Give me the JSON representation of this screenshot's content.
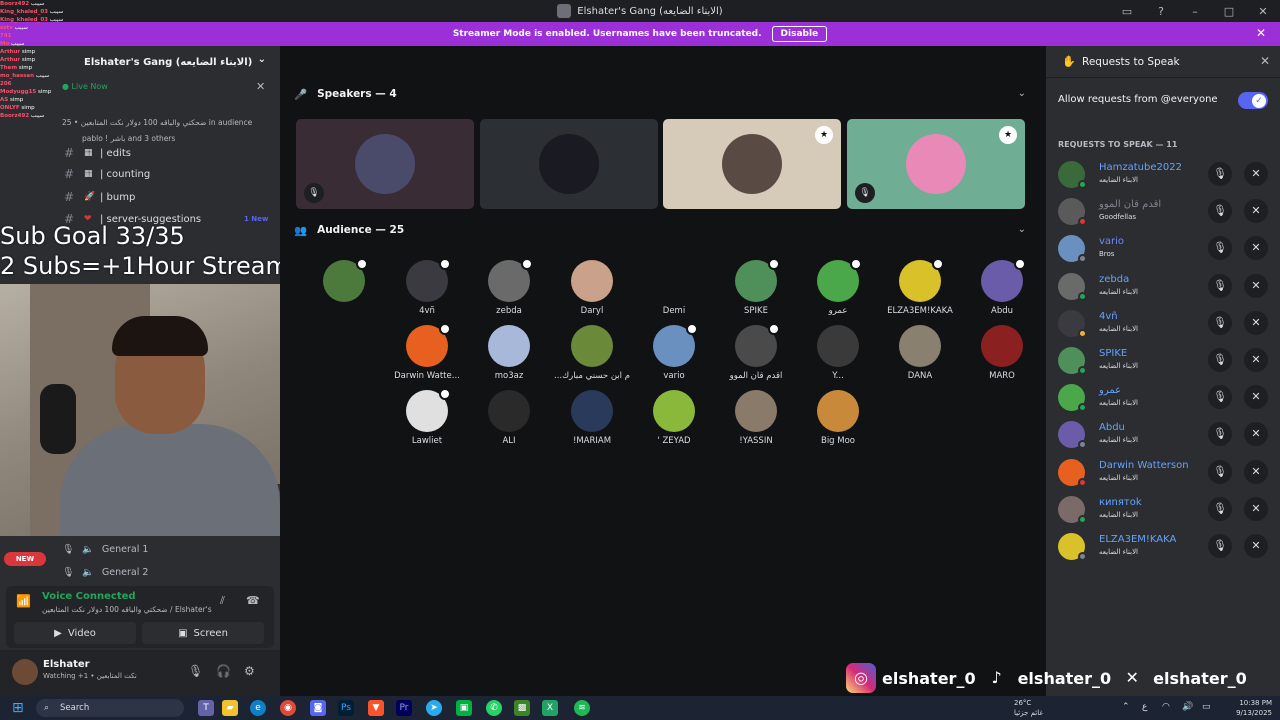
{
  "window": {
    "title": "Elshater's Gang (الابناء الضايعه)",
    "controls": [
      "inbox-icon",
      "help-icon",
      "minimize-icon",
      "maximize-icon",
      "close-icon"
    ]
  },
  "banner": {
    "text": "Streamer Mode is enabled. Usernames have been truncated.",
    "button": "Disable",
    "close": "✕",
    "color": "#9b30d9"
  },
  "sidebar": {
    "server_name": "Elshater's Gang (الابناء الضايعه)",
    "live_label": "Live Now",
    "live_desc": "ضحكتي والباقه 100 دولار نكت المتابعين • 25 in audience",
    "live_sub": "pablo ! باشر and 3 others",
    "channels": [
      {
        "emoji": "▦",
        "name": "| edits",
        "new": ""
      },
      {
        "emoji": "▦",
        "name": "| counting",
        "new": ""
      },
      {
        "emoji": "🚀",
        "name": "| bump",
        "new": ""
      },
      {
        "emoji": "❤",
        "name": "| server-suggestions",
        "new": "1 New"
      }
    ],
    "voice_channels": [
      "General 1",
      "General 2"
    ],
    "new_badge": "NEW"
  },
  "overlay": {
    "sub_goal": "Sub Goal 33/35",
    "subs_line": "2 Subs=+1Hour Stream",
    "chat": [
      {
        "user": "Boorz492",
        "msg": "سيبب"
      },
      {
        "user": "King_khaled_03",
        "msg": "سيبب"
      },
      {
        "user": "King_khaled_03",
        "msg": "سيبب"
      },
      {
        "user": "sstv",
        "msg": "سيبب"
      },
      {
        "user": "741",
        "msg": ""
      },
      {
        "user": "Mo",
        "msg": "سيبب"
      },
      {
        "user": "Arthur",
        "msg": "simp"
      },
      {
        "user": "Arthur",
        "msg": "simp"
      },
      {
        "user": "Them",
        "msg": "simp"
      },
      {
        "user": "mo_hassan",
        "msg": "سيبب"
      },
      {
        "user": "206",
        "msg": ""
      },
      {
        "user": "Modyugg15",
        "msg": "simp"
      },
      {
        "user": "AS",
        "msg": "simp"
      },
      {
        "user": "ONLYF",
        "msg": "simp"
      },
      {
        "user": "Boorz492",
        "msg": "سيبب"
      }
    ]
  },
  "voice_panel": {
    "title": "Voice Connected",
    "subtitle": "ضحكتي والباقه 100 دولار نكت المتابعين / Elshater's...",
    "video_label": "Video",
    "screen_label": "Screen"
  },
  "user": {
    "name": "Elshater",
    "status": "Watching +1 • نكت المتابعين"
  },
  "stage": {
    "speakers_title": "Speakers — 4",
    "audience_title": "Audience — 25",
    "speakers": [
      {
        "bg": "#3a2c34",
        "ava": "#4a4a6a",
        "badge": false,
        "mute": true
      },
      {
        "bg": "#2c2f33",
        "ava": "#1a1a22",
        "badge": false,
        "mute": false
      },
      {
        "bg": "#d6cbb9",
        "ava": "#5a4a44",
        "badge": true,
        "mute": false
      },
      {
        "bg": "#6fae95",
        "ava": "#e889b8",
        "badge": true,
        "mute": true
      }
    ],
    "audience": [
      {
        "name": "",
        "color": "#4b7a3c",
        "mod": true
      },
      {
        "name": "4vñ",
        "color": "#3a3a40",
        "mod": true
      },
      {
        "name": "zebda",
        "color": "#6a6a6a",
        "mod": true
      },
      {
        "name": "Daryl",
        "color": "#caa18a",
        "mod": false
      },
      {
        "name": "Demi",
        "color": "#111214",
        "mod": false
      },
      {
        "name": "SPIKE",
        "color": "#4f8f5a",
        "mod": true
      },
      {
        "name": "عمرو",
        "color": "#4aa84a",
        "mod": true
      },
      {
        "name": "ELZA3EM!KAKA",
        "color": "#d9c12a",
        "mod": true
      },
      {
        "name": "Abdu",
        "color": "#6a5ca8",
        "mod": true
      },
      {
        "name": "Darwin Watte...",
        "color": "#e86020",
        "mod": true
      },
      {
        "name": "mo3az",
        "color": "#a8b8d8",
        "mod": false
      },
      {
        "name": "...م ابن حسني مبارك",
        "color": "#6a8a3a",
        "mod": false
      },
      {
        "name": "vario",
        "color": "#6a90c0",
        "mod": true
      },
      {
        "name": "اقدم قان الموو",
        "color": "#4a4a4a",
        "mod": true
      },
      {
        "name": "Y...",
        "color": "#3a3a3a",
        "mod": false
      },
      {
        "name": "DANA",
        "color": "#8a8070",
        "mod": false
      },
      {
        "name": "MARO",
        "color": "#8a2020",
        "mod": false
      },
      {
        "name": "Lawliet",
        "color": "#e0e0e0",
        "mod": true
      },
      {
        "name": "ALI",
        "color": "#2a2a2a",
        "mod": false
      },
      {
        "name": "!MARIAM",
        "color": "#2a3a5a",
        "mod": false
      },
      {
        "name": "' ZEYAD",
        "color": "#8ab83a",
        "mod": false
      },
      {
        "name": "!YASSIN",
        "color": "#8a7a6a",
        "mod": false
      },
      {
        "name": "Big Moo",
        "color": "#c88a3a",
        "mod": false
      }
    ]
  },
  "requests": {
    "title": "Requests to Speak",
    "allow_label": "Allow requests from @everyone",
    "list_title": "REQUESTS TO SPEAK — 11",
    "items": [
      {
        "name": "Hamzatube2022",
        "role": "الابناء الضايعه",
        "color": "#63a3ff",
        "ava": "#3a6a3a",
        "dot": "#23a55a"
      },
      {
        "name": "اقدم قان الموو",
        "role": "Goodfellas",
        "color": "#80848e",
        "ava": "#5a5a5a",
        "dot": "#da373c"
      },
      {
        "name": "vario",
        "role": "Bros",
        "color": "#6b8cff",
        "ava": "#6a90c0",
        "dot": "#80848e"
      },
      {
        "name": "zebda",
        "role": "الابناء الضايعه",
        "color": "#63a3ff",
        "ava": "#6a6a6a",
        "dot": "#23a55a"
      },
      {
        "name": "4vñ",
        "role": "الابناء الضايعه",
        "color": "#63a3ff",
        "ava": "#3a3a40",
        "dot": "#f0b232"
      },
      {
        "name": "SPIKE",
        "role": "الابناء الضايعه",
        "color": "#63a3ff",
        "ava": "#4f8f5a",
        "dot": "#23a55a"
      },
      {
        "name": "عمرو",
        "role": "الابناء الضايعه",
        "color": "#63a3ff",
        "ava": "#4aa84a",
        "dot": "#23a55a"
      },
      {
        "name": "Abdu",
        "role": "الابناء الضايعه",
        "color": "#63a3ff",
        "ava": "#6a5ca8",
        "dot": "#80848e"
      },
      {
        "name": "Darwin Watterson",
        "role": "الابناء الضايعه",
        "color": "#63a3ff",
        "ava": "#e86020",
        "dot": "#da373c"
      },
      {
        "name": "киnятоk",
        "role": "الابناء الضايعه",
        "color": "#63a3ff",
        "ava": "#7a6a6a",
        "dot": "#23a55a"
      },
      {
        "name": "ELZA3EM!KAKA",
        "role": "الابناء الضايعه",
        "color": "#63a3ff",
        "ava": "#d9c12a",
        "dot": "#80848e"
      }
    ]
  },
  "socials": [
    {
      "icon": "instagram-icon",
      "handle": "elshater_0",
      "color": "#d62976"
    },
    {
      "icon": "tiktok-icon",
      "handle": "elshater_0",
      "color": "#111111"
    },
    {
      "icon": "x-icon",
      "handle": "elshater_0",
      "color": "#111111"
    }
  ],
  "taskbar": {
    "search": "Search",
    "weather_temp": "26°C",
    "weather_desc": "غائم جزئيا",
    "time": "10:38 PM",
    "date": "9/13/2025",
    "lang": "ع"
  }
}
